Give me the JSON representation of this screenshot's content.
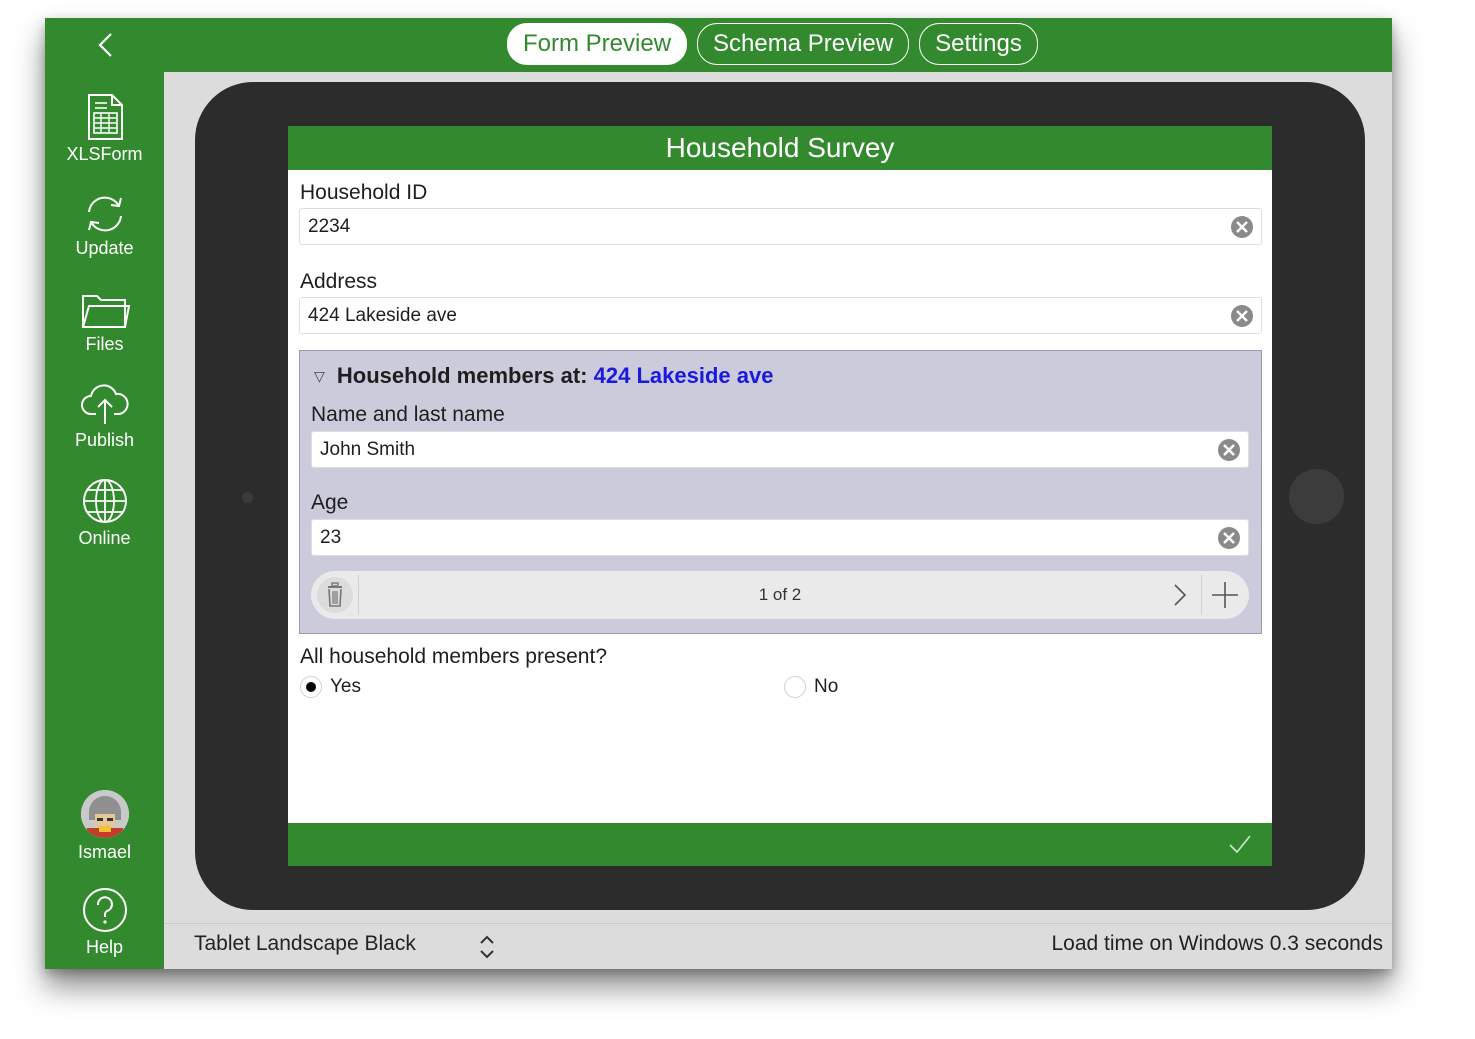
{
  "colors": {
    "brand_green": "#338a2e",
    "link_blue": "#1a1adf",
    "repeat_bg": "#cccbdb"
  },
  "topbar": {
    "back_icon": "chevron-left-icon",
    "tabs": [
      {
        "label": "Form Preview",
        "active": true
      },
      {
        "label": "Schema Preview",
        "active": false
      },
      {
        "label": "Settings",
        "active": false
      }
    ]
  },
  "sidebar": {
    "items": [
      {
        "label": "XLSForm",
        "icon": "spreadsheet-icon"
      },
      {
        "label": "Update",
        "icon": "refresh-icon"
      },
      {
        "label": "Files",
        "icon": "folder-icon"
      },
      {
        "label": "Publish",
        "icon": "cloud-upload-icon"
      },
      {
        "label": "Online",
        "icon": "globe-icon"
      }
    ],
    "user": {
      "label": "Ismael",
      "icon": "avatar"
    },
    "help": {
      "label": "Help",
      "icon": "help-circle-icon"
    }
  },
  "form": {
    "title": "Household Survey",
    "household_id": {
      "label": "Household ID",
      "value": "2234"
    },
    "address": {
      "label": "Address",
      "value": "424 Lakeside ave"
    },
    "repeat": {
      "title_prefix": "Household members at:",
      "title_address": "424 Lakeside ave",
      "name": {
        "label": "Name and last name",
        "value": "John Smith"
      },
      "age": {
        "label": "Age",
        "value": "23"
      },
      "page_indicator": "1 of 2"
    },
    "present": {
      "label": "All household members present?",
      "options": [
        {
          "label": "Yes",
          "selected": true
        },
        {
          "label": "No",
          "selected": false
        }
      ]
    },
    "submit_icon": "checkmark-icon"
  },
  "bottombar": {
    "device": "Tablet Landscape Black",
    "load_time": "Load time on Windows 0.3 seconds"
  }
}
